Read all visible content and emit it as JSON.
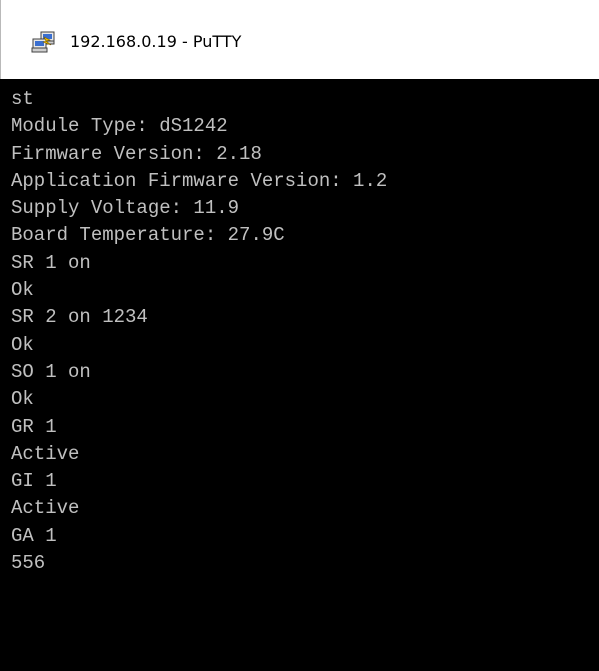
{
  "window": {
    "title": "192.168.0.19 - PuTTY",
    "icon": "putty-icon"
  },
  "terminal": {
    "lines": [
      "st",
      "Module Type: dS1242",
      "Firmware Version: 2.18",
      "Application Firmware Version: 1.2",
      "Supply Voltage: 11.9",
      "Board Temperature: 27.9C",
      "SR 1 on",
      "Ok",
      "SR 2 on 1234",
      "Ok",
      "SO 1 on",
      "Ok",
      "GR 1",
      "Active",
      "GI 1",
      "Active",
      "GA 1",
      "556"
    ],
    "colors": {
      "background": "#000000",
      "text": "#c0c0c0"
    }
  }
}
